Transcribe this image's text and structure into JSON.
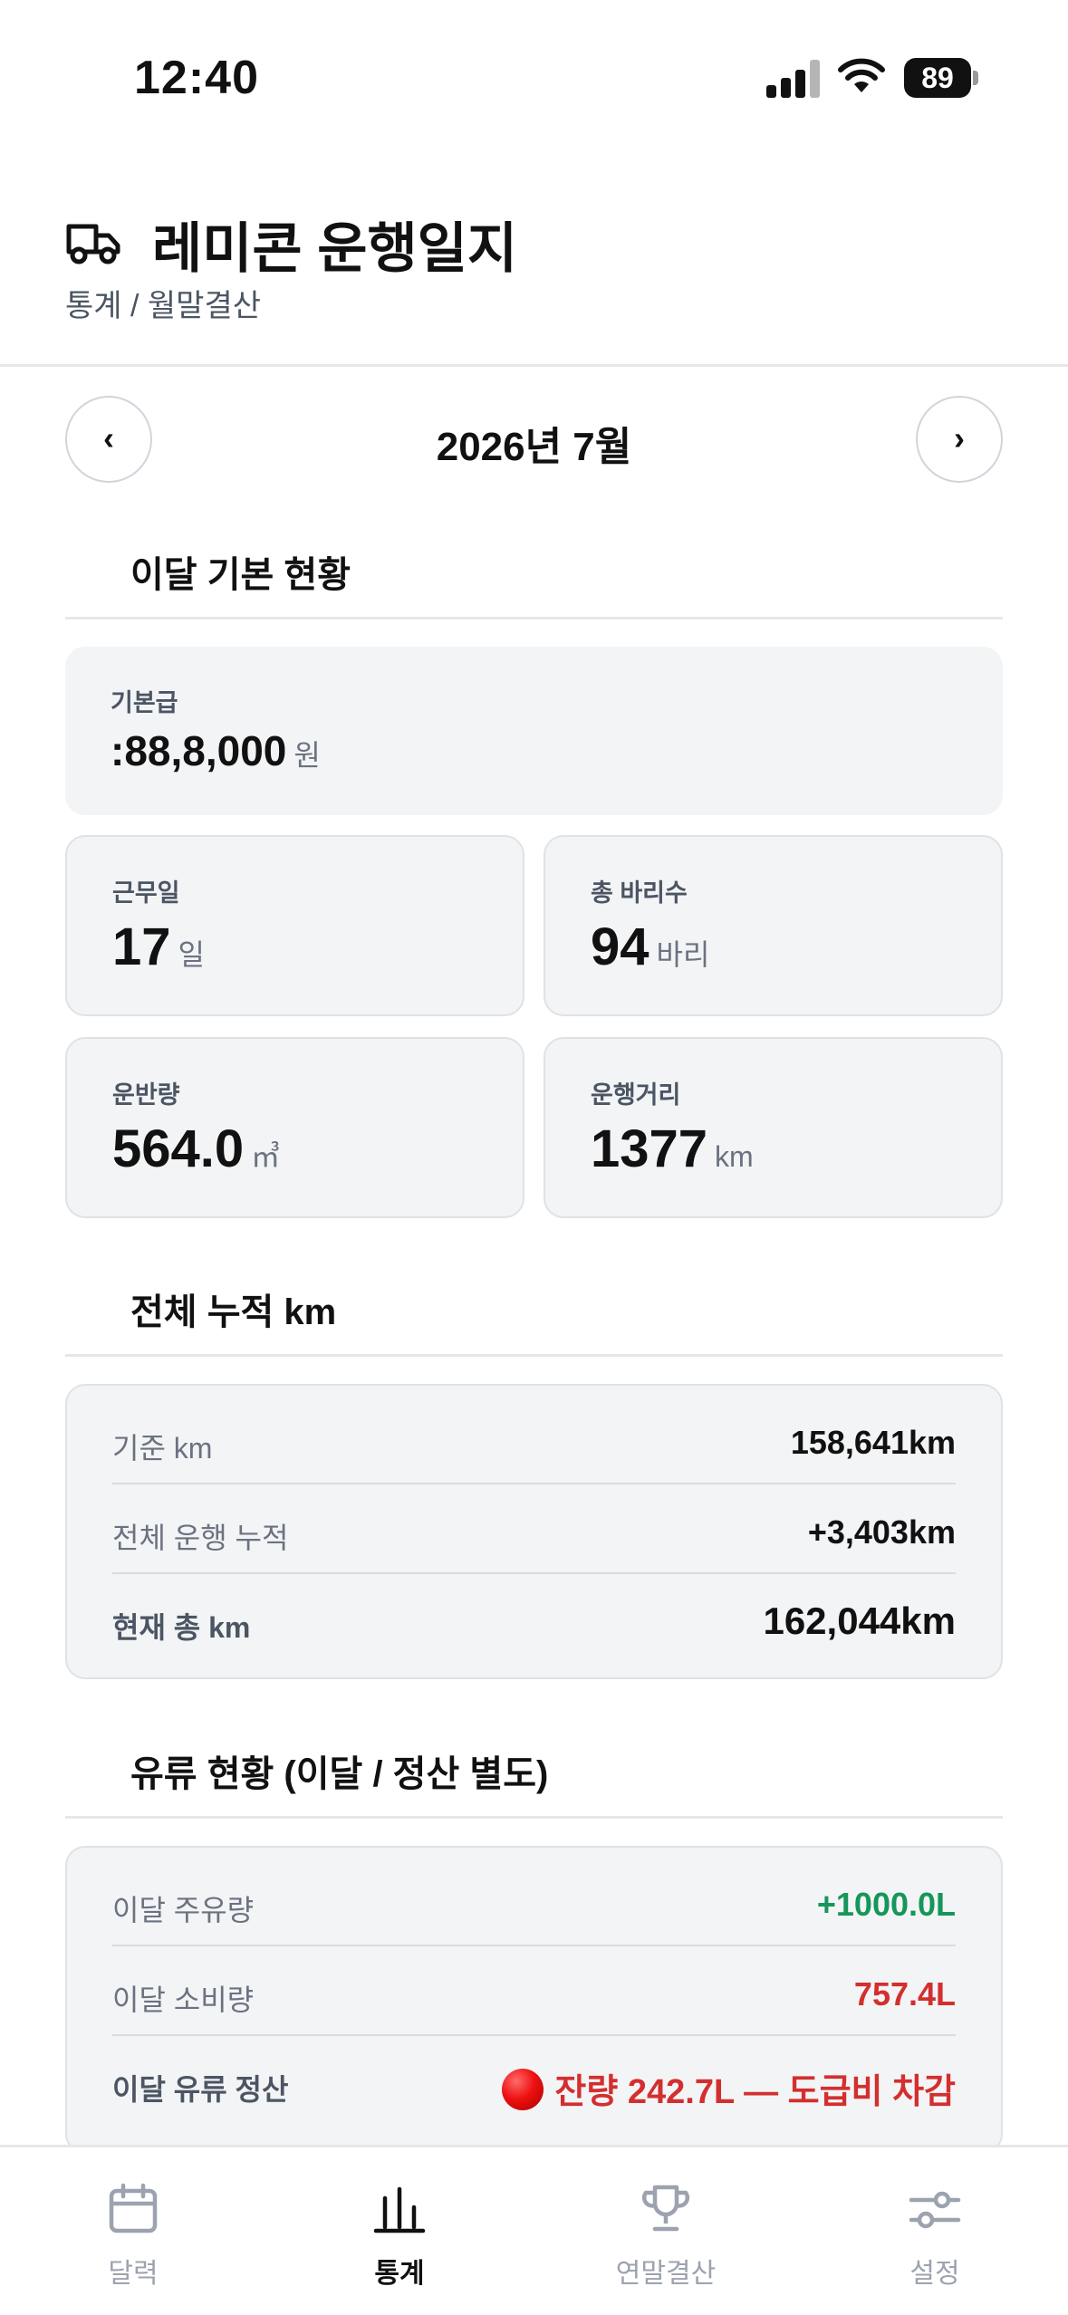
{
  "status_bar": {
    "time": "12:40",
    "battery": "89"
  },
  "header": {
    "title": "레미콘 운행일지",
    "breadcrumb": "통계 / 월말결산"
  },
  "month_nav": {
    "prev": "‹",
    "next": "›",
    "label": "2026년 7월"
  },
  "basic": {
    "section_title": "이달 기본 현황",
    "salary": {
      "label": "기본급",
      "value": ":88,8,000",
      "unit": "원"
    },
    "work_days": {
      "label": "근무일",
      "value": "17",
      "unit": "일"
    },
    "trips": {
      "label": "총 바리수",
      "value": "94",
      "unit": "바리"
    },
    "volume": {
      "label": "운반량",
      "value": "564.0",
      "unit": "㎥"
    },
    "distance": {
      "label": "운행거리",
      "value": "1377",
      "unit": "km"
    }
  },
  "km": {
    "section_title": "전체 누적 km",
    "rows": [
      {
        "label": "기준 km",
        "value": "158,641km"
      },
      {
        "label": "전체 운행 누적",
        "value": "+3,403km"
      },
      {
        "label": "현재 총 km",
        "value": "162,044km"
      }
    ]
  },
  "fuel": {
    "section_title": "유류 현황 (이달 / 정산 별도)",
    "rows": [
      {
        "label": "이달 주유량",
        "value": "+1000.0L"
      },
      {
        "label": "이달 소비량",
        "value": "757.4L"
      },
      {
        "label": "이달 유류 정산",
        "value": "잔량 242.7L — 도급비 차감"
      }
    ]
  },
  "tabs": [
    {
      "label": "달력",
      "icon": "calendar-icon"
    },
    {
      "label": "통계",
      "icon": "bar-chart-icon"
    },
    {
      "label": "연말결산",
      "icon": "trophy-icon"
    },
    {
      "label": "설정",
      "icon": "sliders-icon"
    }
  ],
  "colors": {
    "positive": "#16965a",
    "negative": "#d32f2f",
    "card_bg": "#f3f4f6"
  }
}
